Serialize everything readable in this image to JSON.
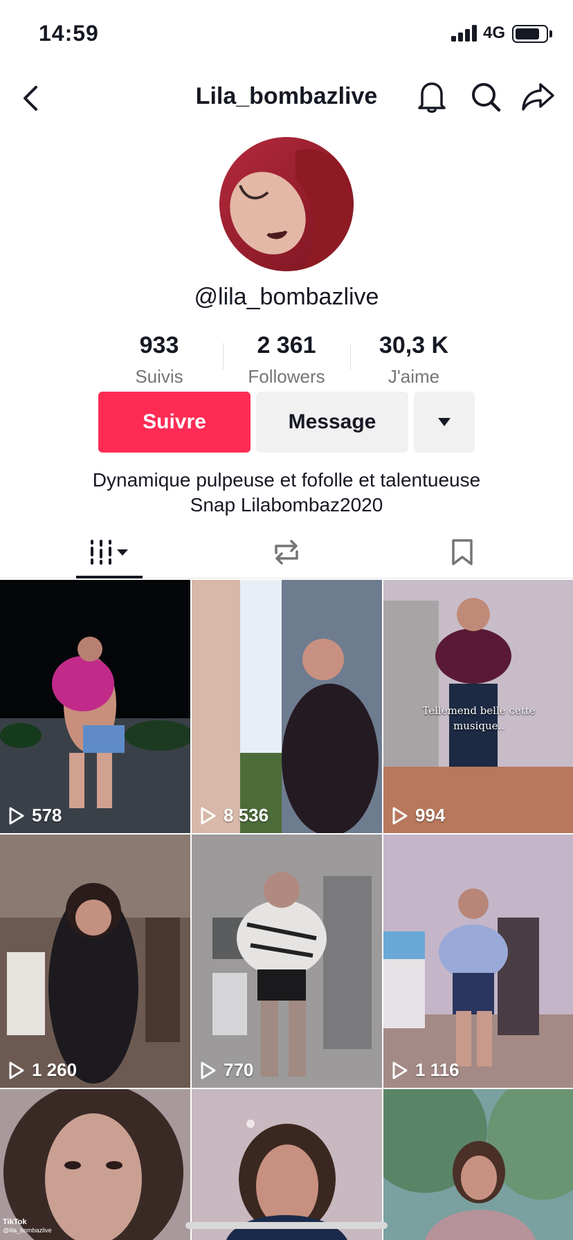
{
  "status_bar": {
    "time": "14:59",
    "network": "4G",
    "battery_level": 0.8
  },
  "header": {
    "title": "Lila_bombazlive"
  },
  "profile": {
    "handle": "@lila_bombazlive",
    "stats": [
      {
        "value": "933",
        "label": "Suivis"
      },
      {
        "value": "2 361",
        "label": "Followers"
      },
      {
        "value": "30,3 K",
        "label": "J'aime"
      }
    ],
    "follow_label": "Suivre",
    "message_label": "Message",
    "bio_line1": "Dynamique pulpeuse et fofolle et talentueuse",
    "bio_line2": "Snap Lilabombaz2020"
  },
  "colors": {
    "accent": "#fe2c55",
    "text": "#161823",
    "muted": "#757575",
    "button_bg": "#f1f1f2"
  },
  "tabs": [
    {
      "icon": "grid-columns-icon",
      "active": true
    },
    {
      "icon": "repost-icon",
      "active": false
    },
    {
      "icon": "bookmark-icon",
      "active": false
    }
  ],
  "videos": [
    {
      "views": "578"
    },
    {
      "views": "8 536"
    },
    {
      "views": "994",
      "caption": "Tellemend belle cette musique.."
    },
    {
      "views": "1 260"
    },
    {
      "views": "770"
    },
    {
      "views": "1 116"
    },
    {
      "views": ""
    },
    {
      "views": ""
    },
    {
      "views": ""
    }
  ],
  "watermark": {
    "brand": "TikTok",
    "user": "@lila_bombazlive"
  }
}
